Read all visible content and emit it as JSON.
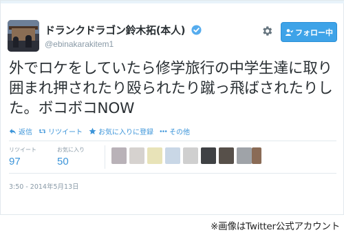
{
  "tweet": {
    "display_name": "ドランクドラゴン鈴木拓(本人)",
    "screen_name": "@ebinakarakitem1",
    "verified": true,
    "follow_button_label": "フォロー中",
    "text": "外でロケをしていたら修学旅行の中学生達に取り囲まれ押されたり殴られたり蹴っ飛ばされたりした。ボコボコNOW",
    "actions": {
      "reply": "返信",
      "retweet": "リツイート",
      "favorite": "お気に入りに登録",
      "more": "その他"
    },
    "stats": {
      "retweets_label": "リツイート",
      "retweets_value": "97",
      "favorites_label": "お気に入り",
      "favorites_value": "50"
    },
    "timestamp": "3:50 - 2014年5月13日"
  },
  "credit": "※画像はTwitter公式アカウント",
  "icons": {
    "verified": "verified-badge-icon",
    "settings": "gear-icon",
    "follow": "follow-person-icon",
    "reply": "reply-arrow-icon",
    "retweet": "retweet-icon",
    "favorite": "star-icon",
    "more": "more-dots-icon"
  },
  "colors": {
    "accent": "#3b94d9",
    "follow_button": "#3ea3e8",
    "verified": "#55acee",
    "muted": "#8899a6",
    "text": "#292f33"
  }
}
